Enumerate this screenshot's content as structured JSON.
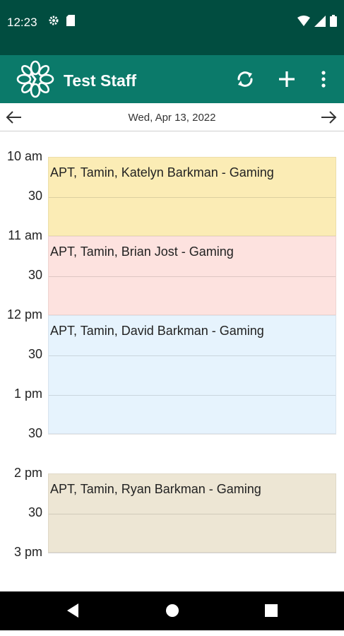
{
  "status_bar": {
    "time": "12:23",
    "left_icons": [
      "gear-icon",
      "sd-card-icon"
    ],
    "right_icons": [
      "wifi-icon",
      "cell-signal-icon",
      "battery-icon"
    ],
    "background": "#014d40"
  },
  "app_bar": {
    "title": "Test Staff",
    "background": "#0b7a6a",
    "actions": [
      "sync-icon",
      "add-icon",
      "more-vert-icon"
    ]
  },
  "date_nav": {
    "date": "Wed, Apr 13, 2022"
  },
  "calendar": {
    "start_hour_label": "10 am",
    "time_labels": [
      "10 am",
      "30",
      "11 am",
      "30",
      "12 pm",
      "30",
      "1 pm",
      "30",
      "2 pm",
      "30",
      "3 pm"
    ],
    "events": [
      {
        "title": "APT, Tamin, Katelyn Barkman - Gaming",
        "start": "10:00",
        "end": "11:00",
        "color": "#fbecb5"
      },
      {
        "title": "APT, Tamin, Brian Jost - Gaming",
        "start": "11:00",
        "end": "12:00",
        "color": "#fde2df"
      },
      {
        "title": "APT, Tamin, David Barkman - Gaming",
        "start": "12:00",
        "end": "13:30",
        "color": "#e6f3fd"
      },
      {
        "title": "APT, Tamin, Ryan Barkman - Gaming",
        "start": "14:00",
        "end": "15:00",
        "color": "#ede6d4"
      }
    ]
  },
  "nav_bar": {
    "buttons": [
      "back-icon",
      "home-icon",
      "recents-icon"
    ]
  }
}
